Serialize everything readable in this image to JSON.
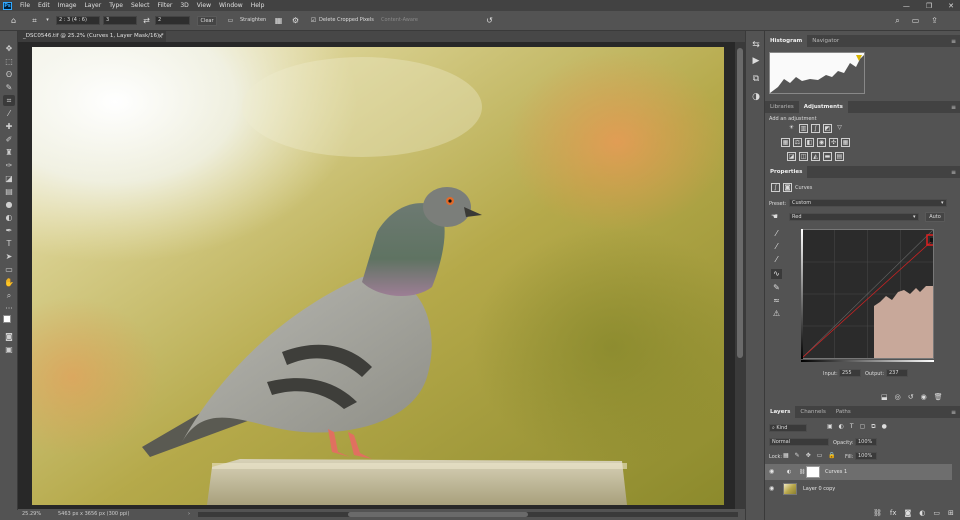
{
  "menubar": {
    "logo": "Ps",
    "items": [
      "File",
      "Edit",
      "Image",
      "Layer",
      "Type",
      "Select",
      "Filter",
      "3D",
      "View",
      "Window",
      "Help"
    ],
    "controls": [
      "—",
      "❐",
      "✕"
    ]
  },
  "options": {
    "ratio": "2 : 3 (4 : 6)",
    "width": "3",
    "height": "2",
    "clear": "Clear",
    "straighten": "Straighten",
    "delete_cropped": "Delete Cropped Pixels",
    "content_aware": "Content-Aware"
  },
  "document": {
    "tab_title": "_DSC0546.tif @ 25.2% (Curves 1, Layer Mask/16) *",
    "close": "×"
  },
  "status": {
    "zoom": "25.29%",
    "dimensions": "5463 px x 3656 px (300 ppi)"
  },
  "panels": {
    "histogram_tabs": [
      "Histogram",
      "Navigator"
    ],
    "adjust_tabs": [
      "Libraries",
      "Adjustments"
    ],
    "add_adjustment": "Add an adjustment",
    "properties_tab": "Properties",
    "curves_label": "Curves",
    "preset_label": "Preset:",
    "preset_value": "Custom",
    "channel_value": "Red",
    "auto_btn": "Auto",
    "input_label": "Input:",
    "input_value": "255",
    "output_label": "Output:",
    "output_value": "237",
    "layer_tabs": [
      "Layers",
      "Channels",
      "Paths"
    ],
    "kind": "Kind",
    "blend": "Normal",
    "opacity_label": "Opacity:",
    "opacity_value": "100%",
    "lock_label": "Lock:",
    "fill_label": "Fill:",
    "fill_value": "100%",
    "layers": [
      {
        "name": "Curves 1"
      },
      {
        "name": "Layer 0 copy"
      }
    ]
  },
  "colors": {
    "selection_red": "#e02020",
    "accent_blue": "#31a8ff",
    "histogram_fill": "#c8a89a"
  }
}
